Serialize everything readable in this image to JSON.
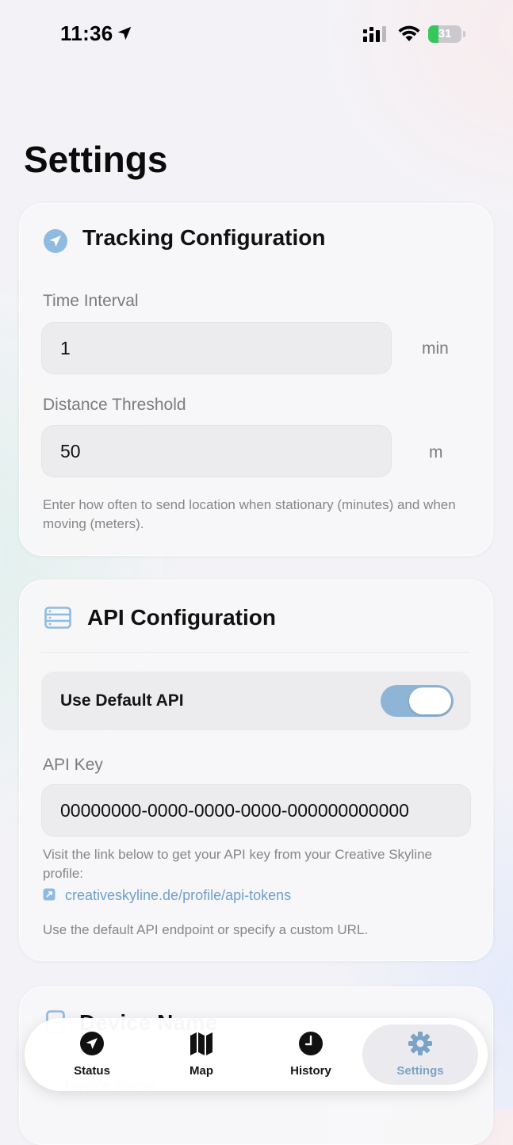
{
  "status_bar": {
    "time": "11:36",
    "battery_percent": "31",
    "battery_level": 0.31,
    "signal_icon": "cellular-signal-icon",
    "wifi_icon": "wifi-icon",
    "location_icon": "location-arrow-icon"
  },
  "page": {
    "title": "Settings"
  },
  "tracking": {
    "title": "Tracking Configuration",
    "icon": "location-arrow-icon",
    "time_interval": {
      "label": "Time Interval",
      "value": "1",
      "unit": "min"
    },
    "distance_threshold": {
      "label": "Distance Threshold",
      "value": "50",
      "unit": "m"
    },
    "help": "Enter how often to send location when stationary (minutes) and when moving (meters)."
  },
  "api": {
    "title": "API Configuration",
    "icon": "server-icon",
    "use_default": {
      "label": "Use Default API",
      "enabled": true
    },
    "api_key": {
      "label": "API Key",
      "value": "00000000-0000-0000-0000-000000000000"
    },
    "help_link_intro": "Visit the link below to get your API key from your Creative Skyline profile:",
    "link": "creativeskyline.de/profile/api-tokens",
    "help_default": "Use the default API endpoint or specify a custom URL."
  },
  "device": {
    "title": "Device Name",
    "field_label": "Device Name"
  },
  "tab_bar": {
    "tabs": [
      {
        "label": "Status",
        "icon": "navigation-arrow-icon",
        "active": false
      },
      {
        "label": "Map",
        "icon": "map-icon",
        "active": false
      },
      {
        "label": "History",
        "icon": "clock-icon",
        "active": false
      },
      {
        "label": "Settings",
        "icon": "gear-icon",
        "active": true
      }
    ]
  },
  "colors": {
    "accent": "#7aa3c7",
    "toggle_on": "#8fb5d6",
    "link": "#6f9fcb",
    "battery_fill": "#34c759"
  }
}
